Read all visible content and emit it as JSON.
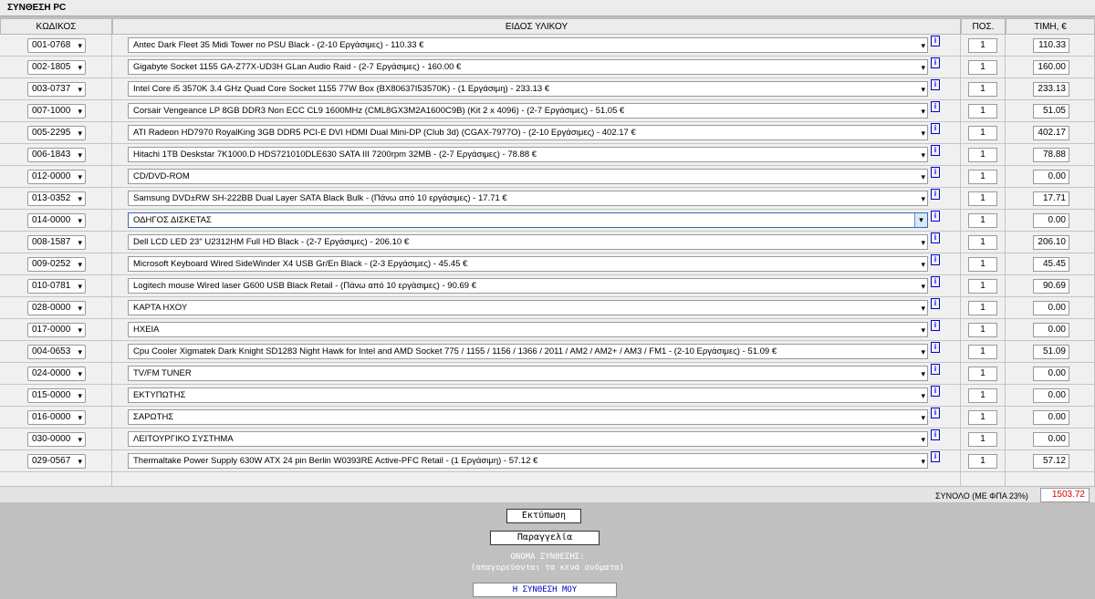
{
  "window_title": "ΣΥΝΘΕΣΗ PC",
  "columns": {
    "code": "ΚΩΔΙΚΟΣ",
    "item": "ΕΙΔΟΣ ΥΛΙΚΟΥ",
    "qty": "ΠΟΣ.",
    "price": "ΤΙΜΗ, €"
  },
  "rows": [
    {
      "code": "001-0768",
      "item": "Antec Dark Fleet 35 Midi Tower no PSU Black - (2-10 Εργάσιμες) - 110.33 €",
      "qty": "1",
      "price": "110.33"
    },
    {
      "code": "002-1805",
      "item": "Gigabyte Socket 1155 GA-Z77X-UD3H GLan Audio Raid - (2-7 Εργάσιμες) - 160.00 €",
      "qty": "1",
      "price": "160.00"
    },
    {
      "code": "003-0737",
      "item": "Intel Core i5 3570K 3.4 GHz Quad Core Socket 1155 77W Box (BX80637I53570K) - (1 Εργάσιμη) - 233.13 €",
      "qty": "1",
      "price": "233.13"
    },
    {
      "code": "007-1000",
      "item": "Corsair Vengeance LP 8GB DDR3 Non ECC CL9 1600MHz (CML8GX3M2A1600C9B) (Kit 2 x 4096) - (2-7 Εργάσιμες) - 51.05 €",
      "qty": "1",
      "price": "51.05"
    },
    {
      "code": "005-2295",
      "item": "ATI Radeon HD7970 RoyalKing 3GB DDR5 PCI-E DVI HDMI Dual Mini-DP (Club 3d) (CGAX-7977O) - (2-10 Εργάσιμες) - 402.17 €",
      "qty": "1",
      "price": "402.17"
    },
    {
      "code": "006-1843",
      "item": "Hitachi 1TB Deskstar 7K1000.D HDS721010DLE630 SATA III 7200rpm 32MB - (2-7 Εργάσιμες) - 78.88 €",
      "qty": "1",
      "price": "78.88"
    },
    {
      "code": "012-0000",
      "item": "CD/DVD-ROM",
      "qty": "1",
      "price": "0.00"
    },
    {
      "code": "013-0352",
      "item": "Samsung DVD±RW SH-222BB Dual Layer SATA Black Bulk - (Πάνω από 10 εργάσιμες) - 17.71 €",
      "qty": "1",
      "price": "17.71"
    },
    {
      "code": "014-0000",
      "item": "ΟΔΗΓΟΣ ΔΙΣΚΕΤΑΣ",
      "qty": "1",
      "price": "0.00",
      "focused": true
    },
    {
      "code": "008-1587",
      "item": "Dell LCD LED 23\" U2312HM Full HD Black - (2-7 Εργάσιμες) - 206.10 €",
      "qty": "1",
      "price": "206.10"
    },
    {
      "code": "009-0252",
      "item": "Microsoft Keyboard Wired SideWinder X4 USB Gr/En Black - (2-3 Εργάσιμες) - 45.45 €",
      "qty": "1",
      "price": "45.45"
    },
    {
      "code": "010-0781",
      "item": "Logitech mouse Wired laser G600 USB Black Retail - (Πάνω από 10 εργάσιμες) - 90.69 €",
      "qty": "1",
      "price": "90.69"
    },
    {
      "code": "028-0000",
      "item": "ΚΑΡΤΑ ΗΧΟΥ",
      "qty": "1",
      "price": "0.00"
    },
    {
      "code": "017-0000",
      "item": "ΗΧΕΙΑ",
      "qty": "1",
      "price": "0.00"
    },
    {
      "code": "004-0653",
      "item": "Cpu Cooler Xigmatek Dark Knight SD1283 Night Hawk for Intel and AMD Socket 775 / 1155 / 1156 / 1366 / 2011 / AM2 / AM2+ / AM3 / FM1 - (2-10 Εργάσιμες) - 51.09 €",
      "qty": "1",
      "price": "51.09"
    },
    {
      "code": "024-0000",
      "item": "TV/FM TUNER",
      "qty": "1",
      "price": "0.00"
    },
    {
      "code": "015-0000",
      "item": "ΕΚΤΥΠΩΤΗΣ",
      "qty": "1",
      "price": "0.00"
    },
    {
      "code": "016-0000",
      "item": "ΣΑΡΩΤΗΣ",
      "qty": "1",
      "price": "0.00"
    },
    {
      "code": "030-0000",
      "item": "ΛΕΙΤΟΥΡΓΙΚΟ ΣΥΣΤΗΜΑ",
      "qty": "1",
      "price": "0.00"
    },
    {
      "code": "029-0567",
      "item": "Thermaltake Power Supply 630W ATX 24 pin Berlin W0393RE Active-PFC Retail - (1 Εργάσιμη) - 57.12 €",
      "qty": "1",
      "price": "57.12"
    }
  ],
  "info_label": "i",
  "dropdown_glyph": "▾",
  "total": {
    "label": "ΣΥΝΟΛΟ (ΜΕ ΦΠΑ 23%)",
    "value": "1503.72"
  },
  "buttons": {
    "print": "Εκτύπωση",
    "order": "Παραγγελία"
  },
  "name_section": {
    "label": "ΟΝΟΜΑ ΣΥΝΘΕΣΗΣ:",
    "hint": "(απαγορεύονται τα κενά ονόματα)",
    "value": "Η ΣΥΝΘΕΣΗ ΜΟΥ"
  },
  "colors": {
    "total_value": "#e00000",
    "info_icon": "#0000cc",
    "name_value": "#0000c8"
  }
}
